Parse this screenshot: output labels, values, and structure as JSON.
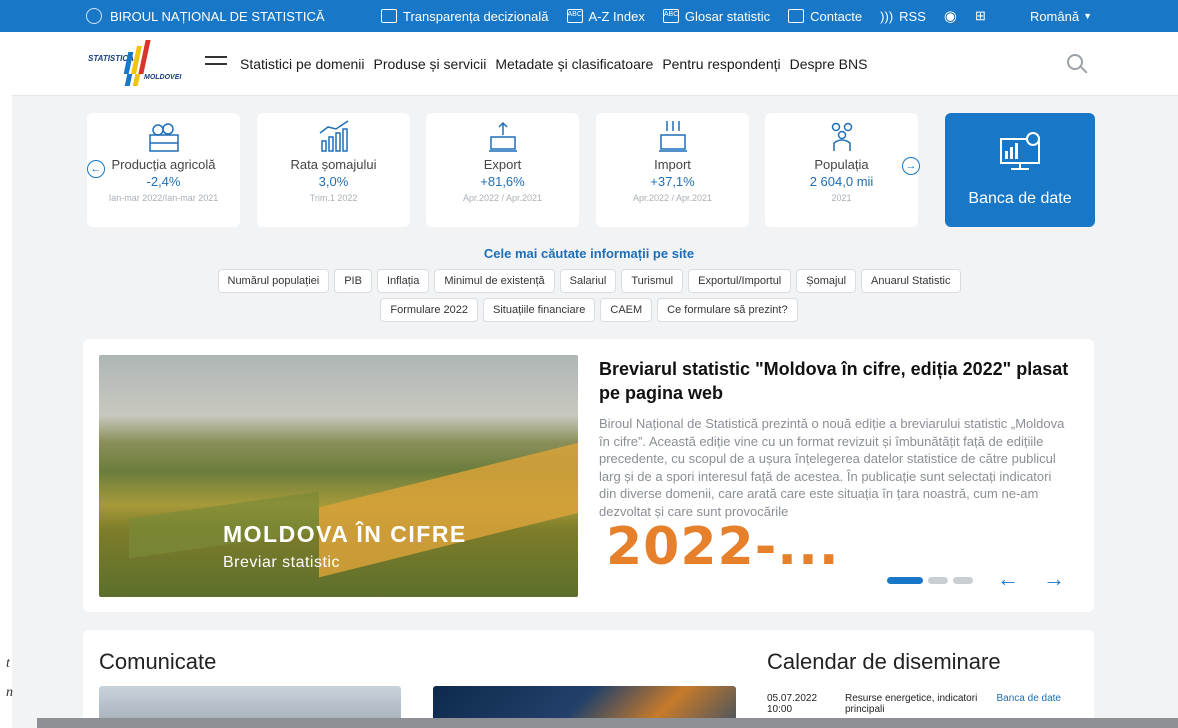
{
  "topbar": {
    "org": "BIROUL NAȚIONAL DE STATISTICĂ",
    "links": [
      "Transparența decizională",
      "A-Z Index",
      "Glosar statistic",
      "Contacte",
      "RSS"
    ],
    "language": "Română"
  },
  "header": {
    "logo_top": "STATISTICA",
    "logo_bottom": "MOLDOVEI",
    "nav": [
      "Statistici pe domenii",
      "Produse și servicii",
      "Metadate și clasificatoare",
      "Pentru respondenți",
      "Despre BNS"
    ]
  },
  "stats": [
    {
      "name": "Producția agricolă",
      "value": "-2,4%",
      "period": "Ian-mar 2022/Ian-mar 2021"
    },
    {
      "name": "Rata șomajului",
      "value": "3,0%",
      "period": "Trim.1 2022"
    },
    {
      "name": "Export",
      "value": "+81,6%",
      "period": "Apr.2022 / Apr.2021"
    },
    {
      "name": "Import",
      "value": "+37,1%",
      "period": "Apr.2022 / Apr.2021"
    },
    {
      "name": "Populația",
      "value": "2 604,0 mii",
      "period": "2021"
    }
  ],
  "databank": {
    "label": "Banca de date"
  },
  "searched": {
    "title": "Cele mai căutate informații pe site",
    "row1": [
      "Numărul populației",
      "PIB",
      "Inflația",
      "Minimul de existență",
      "Salariul",
      "Turismul",
      "Exportul/Importul",
      "Șomajul",
      "Anuarul Statistic"
    ],
    "row2": [
      "Formulare 2022",
      "Situațiile financiare",
      "CAEM",
      "Ce formulare să prezint?"
    ]
  },
  "featured": {
    "image_title": "MOLDOVA ÎN CIFRE",
    "image_subtitle": "Breviar statistic",
    "title": "Breviarul statistic \"Moldova în cifre, ediția 2022\" plasat pe pagina web",
    "body": "Biroul Național de Statistică prezintă o nouă ediție a breviarului statistic „Moldova în cifre”. Această ediție vine cu un format revizuit și îmbunătățit față de edițiile precedente, cu scopul de a ușura înțelegerea datelor statistice de către publicul larg și de a spori interesul față de acestea. În publicație sunt selectați indicatori din diverse domenii, care arată care este situația în țara noastră, cum ne-am dezvoltat și care sunt provocările",
    "overlay": "2022-..."
  },
  "bottom": {
    "communicates": "Comunicate",
    "calendar": "Calendar de diseminare",
    "cal_row": {
      "date": "05.07.2022 10:00",
      "title": "Resurse energetice, indicatori principali",
      "source": "Banca de date"
    }
  },
  "edge": {
    "a": "t",
    "b": "n"
  },
  "colors": {
    "accent": "#1877c7",
    "orange": "#e6802a"
  }
}
